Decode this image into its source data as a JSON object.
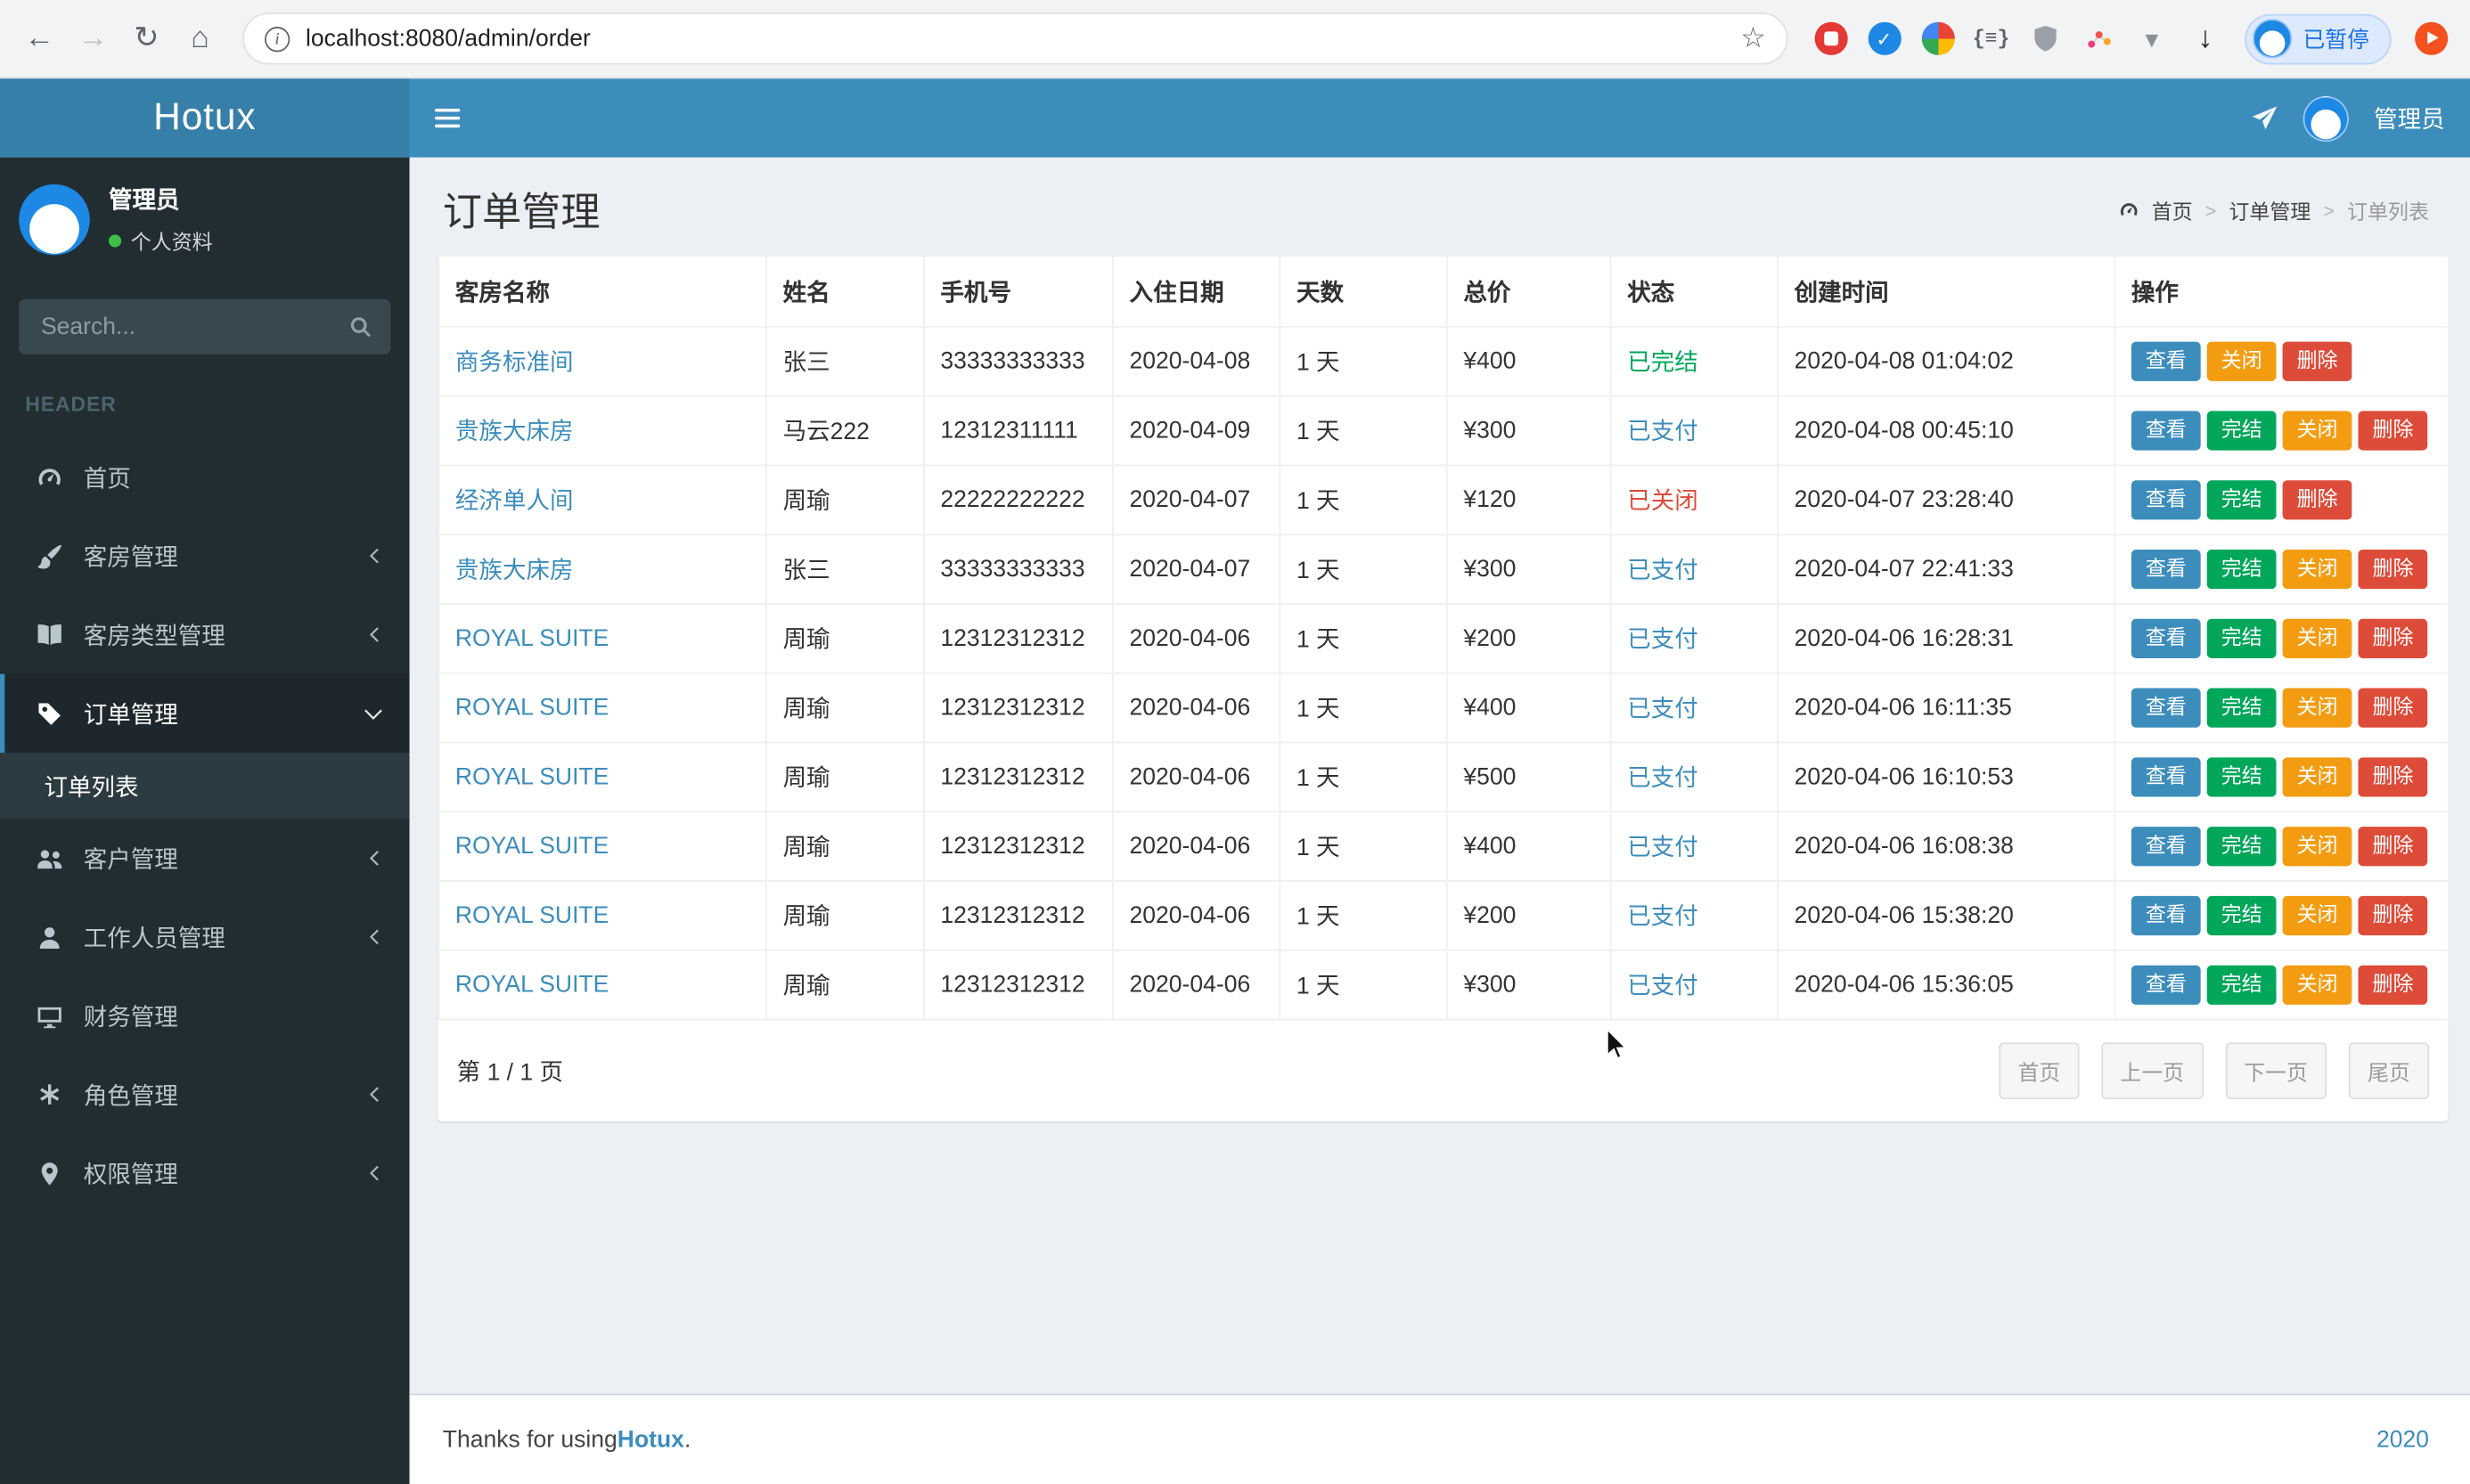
{
  "browser": {
    "url": "localhost:8080/admin/order",
    "profile_chip": "已暂停",
    "icons": {
      "back": "←",
      "forward": "→",
      "reload": "↻",
      "home": "⌂",
      "info": "i",
      "star": "☆",
      "check": "✓",
      "braces": "{≡}",
      "funnel": "▼",
      "download": "↓"
    }
  },
  "navbar": {
    "brand": "Hotux",
    "user": "管理员"
  },
  "sidebar": {
    "user_name": "管理员",
    "user_status": "个人资料",
    "search_placeholder": "Search...",
    "section": "HEADER",
    "menu": [
      {
        "key": "home",
        "icon": "gauge",
        "label": "首页",
        "chevron": "none",
        "active": false
      },
      {
        "key": "rooms",
        "icon": "brush",
        "label": "客房管理",
        "chevron": "left",
        "active": false
      },
      {
        "key": "room-types",
        "icon": "book",
        "label": "客房类型管理",
        "chevron": "left",
        "active": false
      },
      {
        "key": "orders",
        "icon": "tag",
        "label": "订单管理",
        "chevron": "down",
        "active": true,
        "children": [
          {
            "key": "order-list",
            "label": "订单列表",
            "active": true
          }
        ]
      },
      {
        "key": "customers",
        "icon": "users",
        "label": "客户管理",
        "chevron": "left",
        "active": false
      },
      {
        "key": "staff",
        "icon": "user",
        "label": "工作人员管理",
        "chevron": "left",
        "active": false
      },
      {
        "key": "finance",
        "icon": "screen",
        "label": "财务管理",
        "chevron": "none",
        "active": false
      },
      {
        "key": "roles",
        "icon": "asterisk",
        "label": "角色管理",
        "chevron": "left",
        "active": false
      },
      {
        "key": "permissions",
        "icon": "pin",
        "label": "权限管理",
        "chevron": "left",
        "active": false
      }
    ]
  },
  "page": {
    "title": "订单管理",
    "breadcrumb_sep": ">",
    "breadcrumb": [
      {
        "label": "首页",
        "current": false
      },
      {
        "label": "订单管理",
        "current": false
      },
      {
        "label": "订单列表",
        "current": true
      }
    ]
  },
  "table": {
    "headers": [
      "客房名称",
      "姓名",
      "手机号",
      "入住日期",
      "天数",
      "总价",
      "状态",
      "创建时间",
      "操作"
    ],
    "status_colors": {
      "已完结": "#00a65a",
      "已支付": "#3c8dbc",
      "已关闭": "#dd4b39"
    },
    "actions": {
      "view": {
        "label": "查看",
        "color": "#3c8dbc"
      },
      "finish": {
        "label": "完结",
        "color": "#00a65a"
      },
      "close": {
        "label": "关闭",
        "color": "#f39c12"
      },
      "delete": {
        "label": "删除",
        "color": "#dd4b39"
      }
    },
    "rows": [
      {
        "room": "商务标准间",
        "name": "张三",
        "phone": "33333333333",
        "checkin": "2020-04-08",
        "days": "1 天",
        "price": "¥400",
        "status": "已完结",
        "created": "2020-04-08 01:04:02",
        "actions": [
          "view",
          "close",
          "delete"
        ]
      },
      {
        "room": "贵族大床房",
        "name": "马云222",
        "phone": "12312311111",
        "checkin": "2020-04-09",
        "days": "1 天",
        "price": "¥300",
        "status": "已支付",
        "created": "2020-04-08 00:45:10",
        "actions": [
          "view",
          "finish",
          "close",
          "delete"
        ]
      },
      {
        "room": "经济单人间",
        "name": "周瑜",
        "phone": "22222222222",
        "checkin": "2020-04-07",
        "days": "1 天",
        "price": "¥120",
        "status": "已关闭",
        "created": "2020-04-07 23:28:40",
        "actions": [
          "view",
          "finish",
          "delete"
        ]
      },
      {
        "room": "贵族大床房",
        "name": "张三",
        "phone": "33333333333",
        "checkin": "2020-04-07",
        "days": "1 天",
        "price": "¥300",
        "status": "已支付",
        "created": "2020-04-07 22:41:33",
        "actions": [
          "view",
          "finish",
          "close",
          "delete"
        ]
      },
      {
        "room": "ROYAL SUITE",
        "name": "周瑜",
        "phone": "12312312312",
        "checkin": "2020-04-06",
        "days": "1 天",
        "price": "¥200",
        "status": "已支付",
        "created": "2020-04-06 16:28:31",
        "actions": [
          "view",
          "finish",
          "close",
          "delete"
        ]
      },
      {
        "room": "ROYAL SUITE",
        "name": "周瑜",
        "phone": "12312312312",
        "checkin": "2020-04-06",
        "days": "1 天",
        "price": "¥400",
        "status": "已支付",
        "created": "2020-04-06 16:11:35",
        "actions": [
          "view",
          "finish",
          "close",
          "delete"
        ]
      },
      {
        "room": "ROYAL SUITE",
        "name": "周瑜",
        "phone": "12312312312",
        "checkin": "2020-04-06",
        "days": "1 天",
        "price": "¥500",
        "status": "已支付",
        "created": "2020-04-06 16:10:53",
        "actions": [
          "view",
          "finish",
          "close",
          "delete"
        ]
      },
      {
        "room": "ROYAL SUITE",
        "name": "周瑜",
        "phone": "12312312312",
        "checkin": "2020-04-06",
        "days": "1 天",
        "price": "¥400",
        "status": "已支付",
        "created": "2020-04-06 16:08:38",
        "actions": [
          "view",
          "finish",
          "close",
          "delete"
        ]
      },
      {
        "room": "ROYAL SUITE",
        "name": "周瑜",
        "phone": "12312312312",
        "checkin": "2020-04-06",
        "days": "1 天",
        "price": "¥200",
        "status": "已支付",
        "created": "2020-04-06 15:38:20",
        "actions": [
          "view",
          "finish",
          "close",
          "delete"
        ]
      },
      {
        "room": "ROYAL SUITE",
        "name": "周瑜",
        "phone": "12312312312",
        "checkin": "2020-04-06",
        "days": "1 天",
        "price": "¥300",
        "status": "已支付",
        "created": "2020-04-06 15:36:05",
        "actions": [
          "view",
          "finish",
          "close",
          "delete"
        ]
      }
    ]
  },
  "pagination": {
    "info": "第 1 / 1 页",
    "buttons": [
      {
        "key": "first",
        "label": "首页"
      },
      {
        "key": "prev",
        "label": "上一页"
      },
      {
        "key": "next",
        "label": "下一页"
      },
      {
        "key": "last",
        "label": "尾页"
      }
    ]
  },
  "footer": {
    "prefix": "Thanks for using ",
    "brand": "Hotux",
    "suffix": ".",
    "right": "2020"
  }
}
